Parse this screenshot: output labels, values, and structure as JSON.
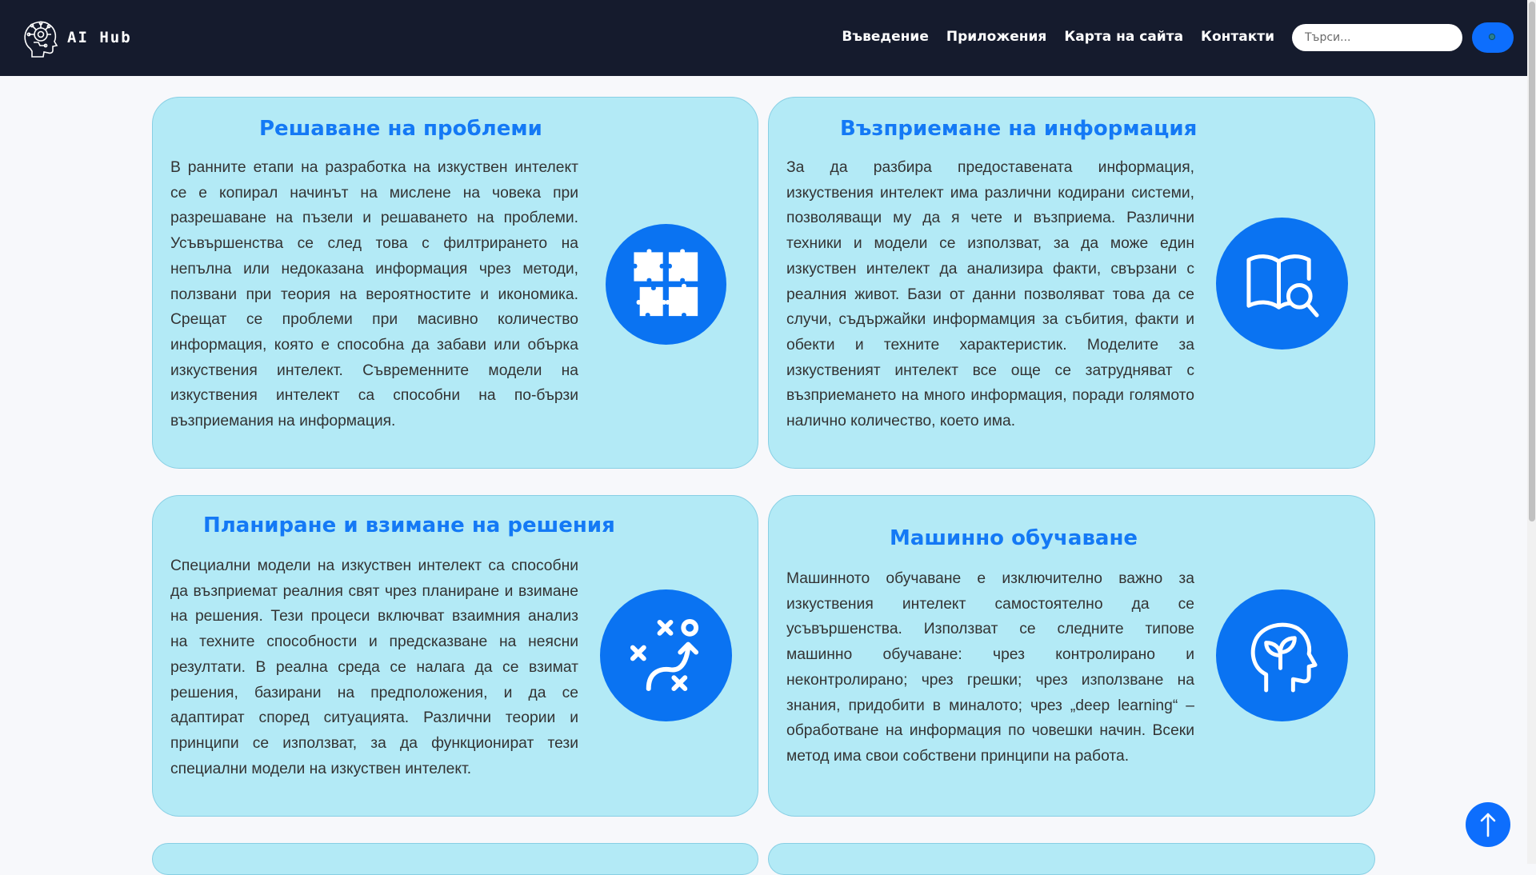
{
  "brand": {
    "name": "AI Hub",
    "logo_icon": "robot-head-logo"
  },
  "nav": {
    "links": [
      {
        "label": "Въведение"
      },
      {
        "label": "Приложения"
      },
      {
        "label": "Карта на сайта"
      },
      {
        "label": "Контакти"
      }
    ]
  },
  "search": {
    "placeholder": "Търси...",
    "value": "",
    "button_icon": "search-icon"
  },
  "cards": [
    {
      "title": "Решаване на проблеми",
      "icon": "puzzle-icon",
      "text": "В ранните етапи на разработка на изкуствен интелект се е копирал начинът на мислене на човека при разрешаване на пъзели и решаването на проблеми. Усъвършенства се след това с филтрирането на непълна или недоказана информация чрез методи, ползвани при теория на вероятностите и икономика. Срещат се проблеми при масивно количество информация, която е способна да забави или обърка изкуствения интелект. Съвременните модели на изкуствения интелект са способни на по-бързи възприемания на информация."
    },
    {
      "title": "Възприемане на информация",
      "icon": "book-search-icon",
      "text": "За да разбира предоставената информация, изкуствения интелект има различни кодирани системи, позволяващи му да я чете и възприема. Различни техники и модели се използват, за да може един изкуствен интелект да анализира факти, свързани с реалния живот. Бази от данни позволяват това да се случи, съдържайки информамция за събития, факти и обекти и техните характеристик. Моделите за изкуственият интелект все още се затрудняват с възприемането на много информация, поради голямото налично количество, което има."
    },
    {
      "title": "Планиране и взимане на решения",
      "icon": "strategy-icon",
      "text": "Специални модели на изкуствен интелект са способни да възприемат реалния свят чрез планиране и взимане на решения. Тези процеси включват взаимния анализ на техните способности и предсказване на неясни резултати. В реална среда се налага да се взимат решения, базирани на предположения, и да се адаптират според ситуацията. Различни теории и принципи се използват, за да функционират тези специални модели на изкуствен интелект."
    },
    {
      "title": "Машинно обучаване",
      "icon": "head-sprout-icon",
      "text": "Машинното обучаване е изключително важно за изкуствения интелект самостоятелно да се усъвършенства. Използват се следните типове машинно обучаване: чрез контролирано и неконтролирано; чрез грешки; чрез използване на знания, придобити в миналото; чрез „deep learning“ – обработване на информация по човешки начин. Всеки метод има свои собствени принципи на работа."
    }
  ],
  "back_to_top": {
    "icon": "arrow-up-icon"
  },
  "colors": {
    "navbar_bg": "#151b2d",
    "card_bg": "#b3eaf6",
    "accent": "#0a73f2",
    "title": "#1479f5"
  }
}
